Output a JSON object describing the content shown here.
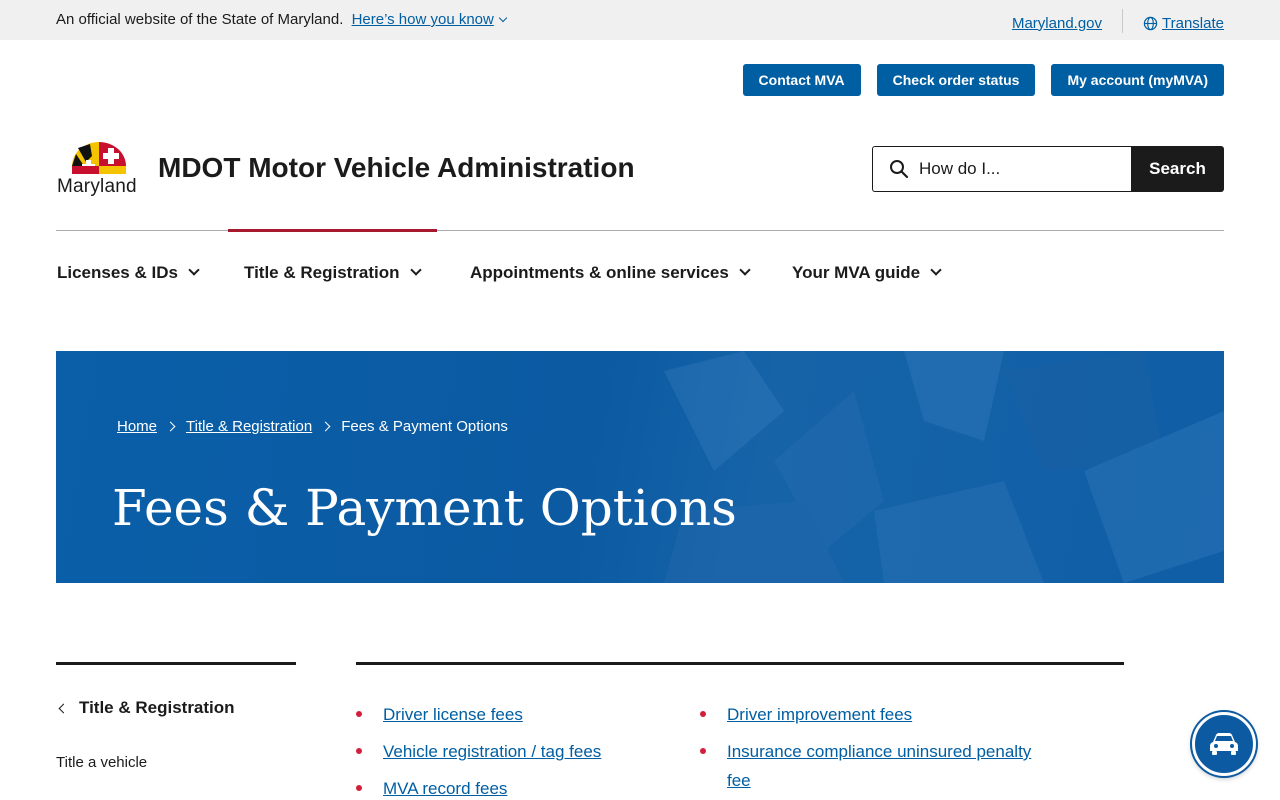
{
  "banner": {
    "official_text": "An official website of the State of Maryland.",
    "how_you_know": "Here’s how you know",
    "maryland_gov": "Maryland.gov",
    "translate": "Translate"
  },
  "utility": {
    "contact": "Contact MVA",
    "order_status": "Check order status",
    "account": "My account (myMVA)"
  },
  "header": {
    "logo_word": "Maryland",
    "site_title": "MDOT Motor Vehicle Administration",
    "search_placeholder": "How do I...",
    "search_button": "Search"
  },
  "nav": [
    {
      "label": "Licenses & IDs"
    },
    {
      "label": "Title & Registration",
      "active": true
    },
    {
      "label": "Appointments & online services"
    },
    {
      "label": "Your MVA guide"
    }
  ],
  "hero": {
    "breadcrumb": [
      "Home",
      "Title & Registration",
      "Fees & Payment Options"
    ],
    "title": "Fees & Payment Options"
  },
  "sidebar": {
    "back_label": "Title & Registration",
    "items": [
      "Title a vehicle"
    ]
  },
  "links": {
    "col1": [
      "Driver license fees",
      "Vehicle registration / tag fees",
      "MVA record fees"
    ],
    "col2": [
      "Driver improvement fees",
      "Insurance compliance uninsured penalty fee"
    ]
  },
  "colors": {
    "brand_blue": "#005ea2",
    "hero_blue": "#0b5aa2",
    "accent_red": "#a6192e",
    "bullet_red": "#d31f3c"
  },
  "icons": {
    "search": "search-icon",
    "globe": "globe-icon",
    "chat": "car-chat-icon"
  }
}
